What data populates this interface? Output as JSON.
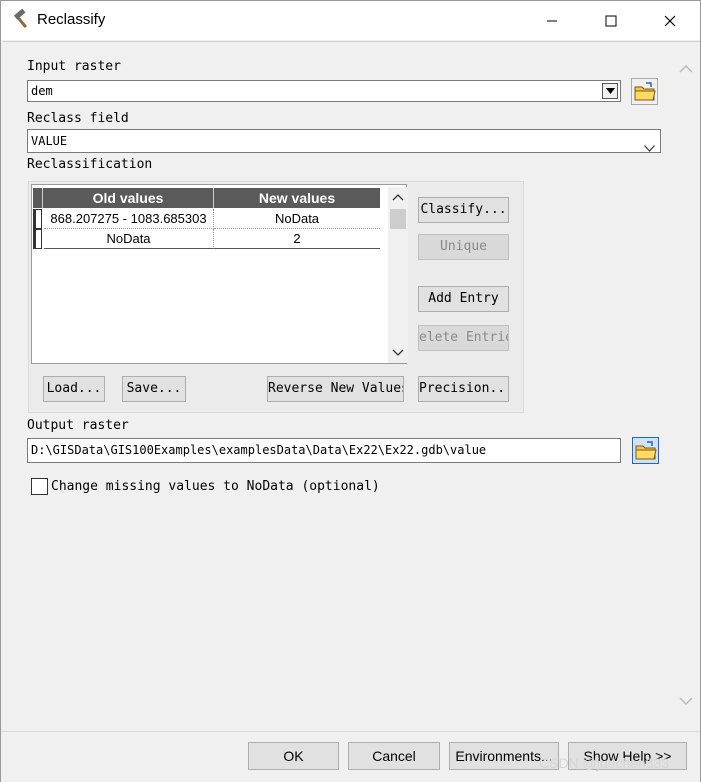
{
  "window": {
    "title": "Reclassify"
  },
  "input_raster": {
    "label": "Input raster",
    "value": "dem"
  },
  "reclass_field": {
    "label": "Reclass field",
    "value": "VALUE"
  },
  "reclassification": {
    "label": "Reclassification",
    "columns": [
      "Old values",
      "New values"
    ],
    "rows": [
      {
        "old": "868.207275 - 1083.685303",
        "new": "NoData"
      },
      {
        "old": "NoData",
        "new": "2"
      }
    ]
  },
  "side_buttons": {
    "classify": "Classify...",
    "unique": "Unique",
    "add_entry": "Add Entry",
    "delete_entries": "elete Entrie"
  },
  "bottom_buttons": {
    "load": "Load...",
    "save": "Save...",
    "reverse": "Reverse New Values",
    "precision": "Precision..."
  },
  "output_raster": {
    "label": "Output raster",
    "value": "D:\\GISData\\GIS100Examples\\examplesData\\Data\\Ex22\\Ex22.gdb\\value"
  },
  "missing_values": {
    "label": "Change missing values to NoData (optional)",
    "checked": false
  },
  "footer": {
    "ok": "OK",
    "cancel": "Cancel",
    "environments": "Environments...",
    "show_help": "Show Help >>"
  },
  "watermark": "CSDN @juechen333"
}
